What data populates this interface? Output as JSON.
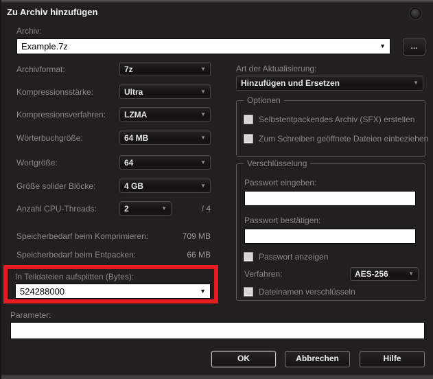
{
  "dialog": {
    "title": "Zu Archiv hinzufügen",
    "background_color": "#211f20",
    "highlight_color": "#e81b22"
  },
  "archive": {
    "label": "Archiv:",
    "value": "Example.7z",
    "browse_label": "..."
  },
  "left_fields": [
    {
      "label": "Archivformat:",
      "value": "7z"
    },
    {
      "label": "Kompressionsstärke:",
      "value": "Ultra"
    },
    {
      "label": "Kompressionsverfahren:",
      "value": "LZMA"
    },
    {
      "label": "Wörterbuchgröße:",
      "value": "64 MB"
    },
    {
      "label": "Wortgröße:",
      "value": "64"
    },
    {
      "label": "Größe solider Blöcke:",
      "value": "4 GB"
    },
    {
      "label": "Anzahl CPU-Threads:",
      "value": "2",
      "suffix": "/ 4"
    }
  ],
  "memory": [
    {
      "label": "Speicherbedarf beim Komprimieren:",
      "value": "709 MB"
    },
    {
      "label": "Speicherbedarf beim Entpacken:",
      "value": "66 MB"
    }
  ],
  "split": {
    "label": "In Teildateien aufsplitten (Bytes):",
    "value": "524288000"
  },
  "update_mode": {
    "label": "Art der Aktualisierung:",
    "value": "Hinzufügen und Ersetzen"
  },
  "options_group": {
    "title": "Optionen",
    "checkbox_sfx": "Selbstentpackendes Archiv (SFX) erstellen",
    "checkbox_shared": "Zum Schreiben geöffnete Dateien einbeziehen"
  },
  "encryption_group": {
    "title": "Verschlüsselung",
    "password_enter_label": "Passwort eingeben:",
    "password_enter_value": "",
    "password_confirm_label": "Passwort bestätigen:",
    "password_confirm_value": "",
    "show_password_label": "Passwort anzeigen",
    "method_label": "Verfahren:",
    "method_value": "AES-256",
    "encrypt_names_label": "Dateinamen verschlüsseln"
  },
  "parameter": {
    "label": "Parameter:",
    "value": ""
  },
  "buttons": {
    "ok": "OK",
    "cancel": "Abbrechen",
    "help": "Hilfe"
  }
}
